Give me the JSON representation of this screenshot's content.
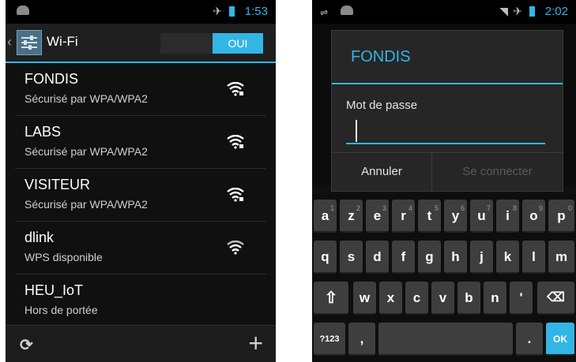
{
  "left": {
    "status": {
      "time": "1:53"
    },
    "actionbar": {
      "title": "Wi-Fi",
      "toggle_label": "OUI"
    },
    "networks": [
      {
        "ssid": "FONDIS",
        "detail": "Sécurisé par WPA/WPA2",
        "secured": true
      },
      {
        "ssid": "LABS",
        "detail": "Sécurisé par WPA/WPA2",
        "secured": true
      },
      {
        "ssid": "VISITEUR",
        "detail": "Sécurisé par WPA/WPA2",
        "secured": true
      },
      {
        "ssid": "dlink",
        "detail": "WPS disponible",
        "secured": false
      },
      {
        "ssid": "HEU_IoT",
        "detail": "Hors de portée",
        "secured": false
      }
    ],
    "bottombar": {
      "refresh_icon": "refresh-icon",
      "add_icon": "plus-icon"
    }
  },
  "right": {
    "status": {
      "time": "2:02"
    },
    "dialog": {
      "title": "FONDIS",
      "password_label": "Mot de passe",
      "password_value": "",
      "cancel_label": "Annuler",
      "connect_label": "Se connecter"
    },
    "keyboard": {
      "row1": [
        "a",
        "z",
        "e",
        "r",
        "t",
        "y",
        "u",
        "i",
        "o",
        "p"
      ],
      "row1_hints": [
        "1",
        "2",
        "3",
        "4",
        "5",
        "6",
        "7",
        "8",
        "9",
        "0"
      ],
      "row2": [
        "q",
        "s",
        "d",
        "f",
        "g",
        "h",
        "j",
        "k",
        "l",
        "m"
      ],
      "row3": [
        "w",
        "x",
        "c",
        "v",
        "b",
        "n",
        "'"
      ],
      "symbols_label": "?123",
      "comma_label": ",",
      "period_label": ".",
      "ok_label": "OK"
    }
  },
  "colors": {
    "accent": "#33b5e5",
    "background": "#101010"
  }
}
